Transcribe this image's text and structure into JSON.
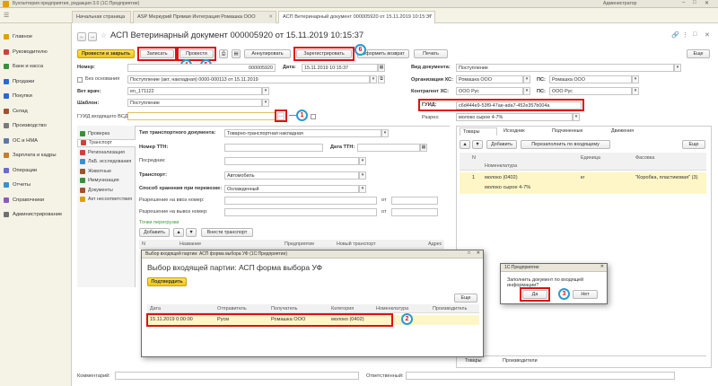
{
  "window": {
    "title": "Бухгалтерия предприятия, редакция 3.0 (1С:Предприятие)",
    "user": "Администратор"
  },
  "tabs": [
    {
      "label": "Начальная страница"
    },
    {
      "label": "ASP Меркурий Прямая Интеграция Ромашка ООО"
    },
    {
      "label": "АСП Ветеринарный документ 000005920 от 15.11.2019 10:15:37"
    }
  ],
  "sidebar": {
    "items": [
      {
        "label": "Главное",
        "color": "#e0a000"
      },
      {
        "label": "Руководителю",
        "color": "#d04040"
      },
      {
        "label": "Банк и касса",
        "color": "#3a8f3a"
      },
      {
        "label": "Продажи",
        "color": "#2a6ad0"
      },
      {
        "label": "Покупки",
        "color": "#2a6ad0"
      },
      {
        "label": "Склад",
        "color": "#a0522d"
      },
      {
        "label": "Производство",
        "color": "#7a7a7a"
      },
      {
        "label": "ОС и НМА",
        "color": "#5a7aa0"
      },
      {
        "label": "Зарплата и кадры",
        "color": "#c08030"
      },
      {
        "label": "Операции",
        "color": "#6a6ad0"
      },
      {
        "label": "Отчеты",
        "color": "#3a8fd0"
      },
      {
        "label": "Справочники",
        "color": "#8a5ac0"
      },
      {
        "label": "Администрирование",
        "color": "#707070"
      }
    ]
  },
  "doc": {
    "title": "АСП Ветеринарный документ 000005920 от 15.11.2019 10:15:37"
  },
  "toolbar": {
    "post_close": "Провести и закрыть",
    "save": "Записать",
    "post": "Провести",
    "cancel": "Аннулировать",
    "register": "Зарегистрировать",
    "return": "Оформить возврат",
    "print": "Печать",
    "more": "Еще"
  },
  "form": {
    "number_label": "Номер:",
    "number_value": "000005920",
    "date_label": "Дата:",
    "date_value": "15.11.2019 10:15:37",
    "basis_label": "Без основания",
    "basis_value": "Поступление (акт, накладная) 0000-000113 от 15.11.2019",
    "vet_label": "Вет врач:",
    "vet_value": "en_171122",
    "template_label": "Шаблон:",
    "template_value": "Поступление",
    "guid_in_label": "ГУИД входящего ВСД:",
    "guid_in_value": "",
    "doc_type_label": "Вид документа:",
    "doc_type_value": "Поступление",
    "org_label": "Организация ХС:",
    "org_value": "Ромашка ООО",
    "ps_label": "ПС:",
    "ps_value": "Ромашка ООО",
    "contr_label": "Контрагент ХС:",
    "contr_value": "ООО Рус",
    "ps2_label": "ПС:",
    "ps2_value": "ООО Рус",
    "guid_label": "ГУИД:",
    "guid_value": "c6d444e9-53f9-47ae-ada7-452e357b004a",
    "breakdown_label": "Разрез:",
    "breakdown_value": "молоко сырое 4-7%"
  },
  "vtabs": [
    {
      "label": "Проверка",
      "color": "#3a8f3a"
    },
    {
      "label": "Транспорт",
      "color": "#d04040"
    },
    {
      "label": "Регионализация",
      "color": "#d04040"
    },
    {
      "label": "ЛаБ. исследования",
      "color": "#3a8fd0"
    },
    {
      "label": "Животные",
      "color": "#a0522d"
    },
    {
      "label": "Иммунизация",
      "color": "#3a8f3a"
    },
    {
      "label": "Документы",
      "color": "#a0522d"
    },
    {
      "label": "Акт несоответствия",
      "color": "#e0a000"
    }
  ],
  "transport": {
    "type_label": "Тип транспортного документа:",
    "type_value": "Товарно-транспортная накладная",
    "ttn_num_label": "Номер ТТН:",
    "ttn_date_label": "Дата ТТН:",
    "intermediary_label": "Посредник:",
    "transport_label": "Транспорт:",
    "transport_value": "Автомобиль",
    "storage_label": "Способ хранения при перевозке:",
    "storage_value": "Охлажденный",
    "import_label": "Разрешение на ввоз номер:",
    "export_label": "Разрешение на вывоз номер:",
    "from_label": "от",
    "transfer_points": "Точки перегрузки",
    "add": "Добавить",
    "add_transport": "Внести транспорт",
    "col_n": "N",
    "col_name": "Название",
    "col_enterprise": "Предприятие",
    "col_new_transport": "Новый транспорт",
    "col_address": "Адрес"
  },
  "right_tabs": [
    {
      "label": "Товары"
    },
    {
      "label": "Исходник"
    },
    {
      "label": "Подчиненные"
    },
    {
      "label": "Движения"
    }
  ],
  "goods": {
    "add": "Добавить",
    "refill": "Перезаполнить по входящему",
    "col_n": "N",
    "col_nom": "Номенклатура",
    "col_unit": "Единица",
    "col_pack": "Фасовка",
    "rows": [
      {
        "n": "1",
        "nom": "молоко (0402)",
        "nom2": "молоко сырое 4-7%",
        "unit": "кг",
        "pack": "\"Коробка, пластиковая\" (3)"
      }
    ]
  },
  "bottom_tabs": [
    {
      "label": "Товары"
    },
    {
      "label": "Производители"
    }
  ],
  "dialog1": {
    "window_title": "Выбор входящей партии: АСП форма выбора УФ (1С:Предприятие)",
    "title": "Выбор входящей партии: АСП форма выбора УФ",
    "confirm": "Подтвердить",
    "more": "Еще",
    "cols": [
      "Дата",
      "Отправитель",
      "Получатель",
      "Категория",
      "Номенклатура",
      "Производитель"
    ],
    "row": {
      "date": "15.11.2019 0:00:00",
      "sender": "Русм",
      "receiver": "Ромашка ООО",
      "category": "молоко (0402)"
    }
  },
  "dialog2": {
    "window_title": "1С:Предприятие",
    "question": "Заполнить документ по входящей информации?",
    "yes": "Да",
    "no": "Нет"
  },
  "footer": {
    "comment_label": "Комментарий:",
    "responsible_label": "Ответственный:"
  },
  "callouts": [
    "1",
    "2",
    "3",
    "4",
    "5",
    "6"
  ]
}
